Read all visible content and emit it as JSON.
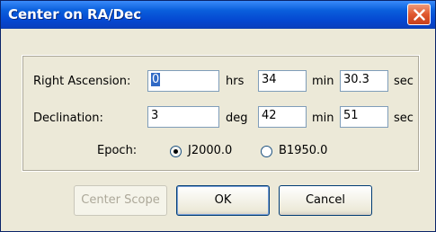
{
  "window": {
    "title": "Center on RA/Dec"
  },
  "icons": {
    "close": "close-icon"
  },
  "colors": {
    "titlebar": "#0a5fdc",
    "close": "#e0582e",
    "selection": "#316ac5"
  },
  "ra": {
    "label": "Right Ascension:",
    "hours_value": "0",
    "hours_unit": "hrs",
    "minutes_value": "34",
    "minutes_unit": "min",
    "seconds_value": "30.3",
    "seconds_unit": "sec"
  },
  "dec": {
    "label": "Declination:",
    "degrees_value": "3",
    "degrees_unit": "deg",
    "minutes_value": "42",
    "minutes_unit": "min",
    "seconds_value": "51",
    "seconds_unit": "sec"
  },
  "epoch": {
    "label": "Epoch:",
    "options": [
      "J2000.0",
      "B1950.0"
    ],
    "selected": "J2000.0"
  },
  "buttons": {
    "center_scope": "Center Scope",
    "ok": "OK",
    "cancel": "Cancel"
  }
}
